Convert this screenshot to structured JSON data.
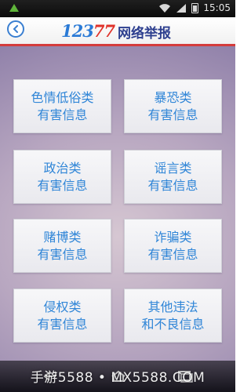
{
  "status_bar": {
    "time": "15:05",
    "icons": [
      "notification-icon",
      "wifi-icon",
      "signal-icon",
      "battery-icon"
    ]
  },
  "header": {
    "logo_number_part1": "123",
    "logo_number_part2": "77",
    "logo_text": "网络举报",
    "back_icon": "chevron-left-icon"
  },
  "tiles": [
    {
      "label": "色情低俗类\n有害信息"
    },
    {
      "label": "暴恐类\n有害信息"
    },
    {
      "label": "政治类\n有害信息"
    },
    {
      "label": "谣言类\n有害信息"
    },
    {
      "label": "赌博类\n有害信息"
    },
    {
      "label": "诈骗类\n有害信息"
    },
    {
      "label": "侵权类\n有害信息"
    },
    {
      "label": "其他违法\n和不良信息"
    }
  ],
  "watermark": "手游5588 • MX5588.COM",
  "colors": {
    "tile_text": "#2f85d7",
    "logo_blue": "#2a7ad6",
    "logo_red": "#e0322a",
    "header_border": "#d43c3c"
  }
}
